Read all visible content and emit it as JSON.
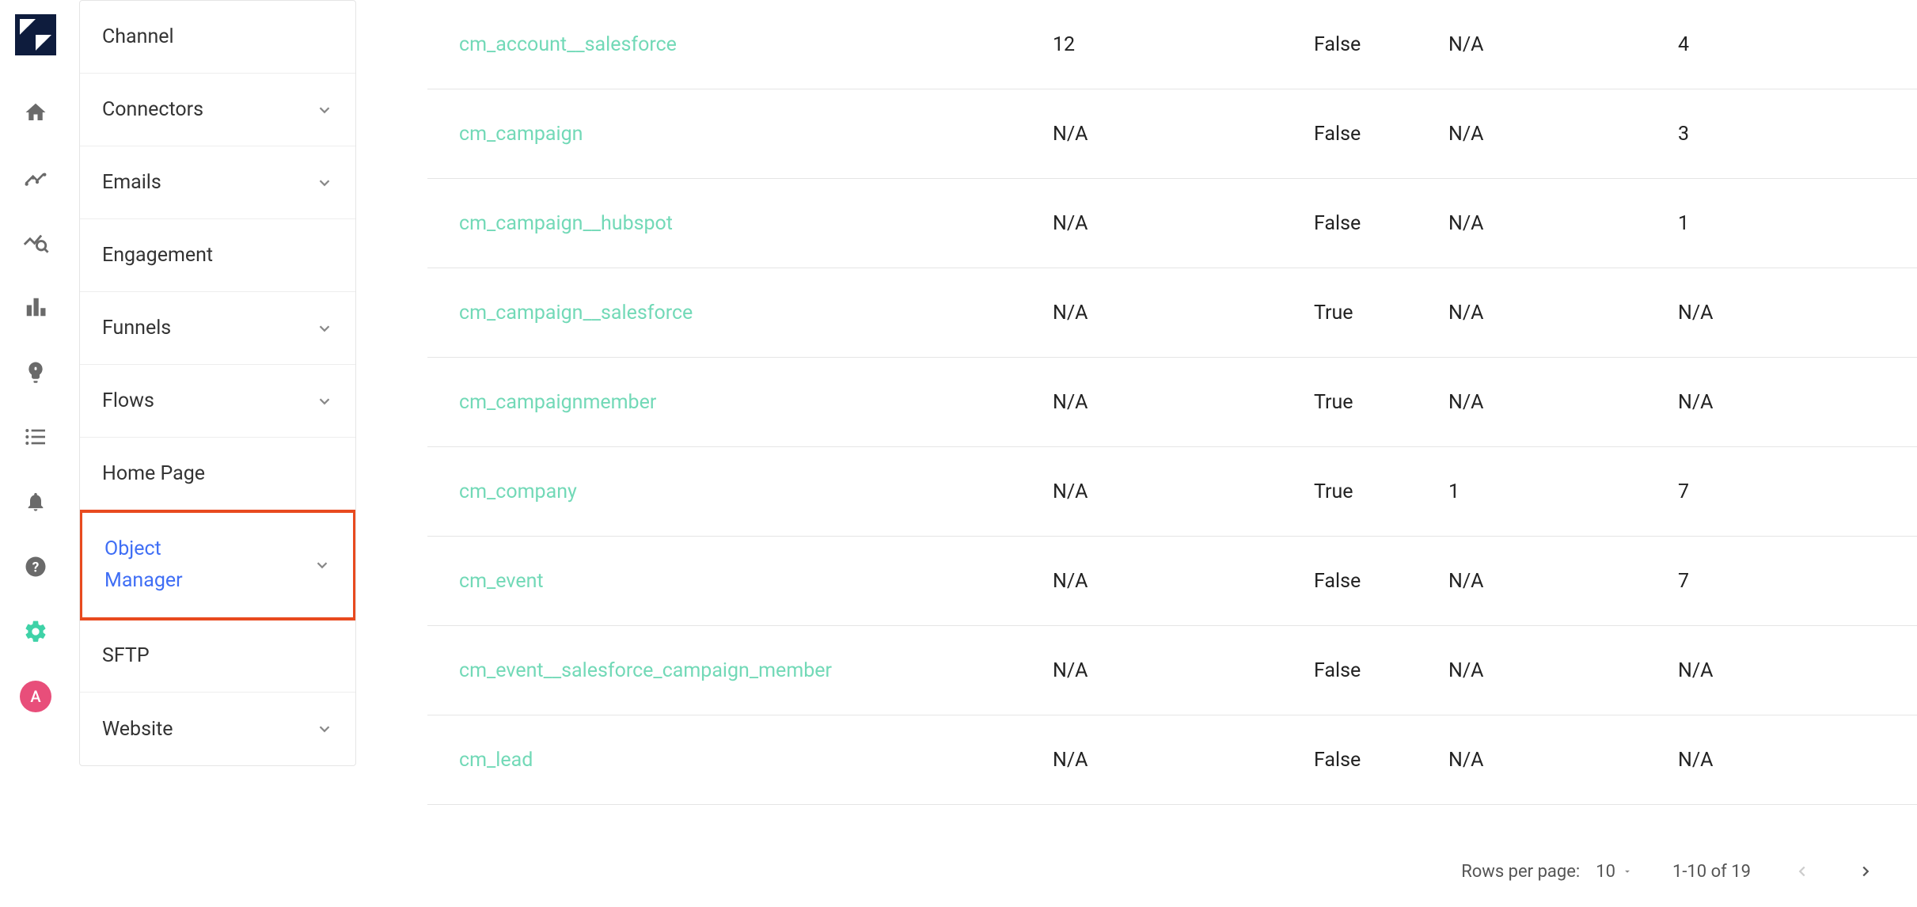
{
  "rail": {
    "avatar_letter": "A"
  },
  "sidebar": {
    "items": [
      {
        "label": "Channel",
        "expandable": false
      },
      {
        "label": "Connectors",
        "expandable": true
      },
      {
        "label": "Emails",
        "expandable": true
      },
      {
        "label": "Engagement",
        "expandable": false
      },
      {
        "label": "Funnels",
        "expandable": true
      },
      {
        "label": "Flows",
        "expandable": true
      },
      {
        "label": "Home Page",
        "expandable": false
      },
      {
        "label_line1": "Object",
        "label_line2": "Manager",
        "expandable": true,
        "highlighted": true
      },
      {
        "label": "SFTP",
        "expandable": false
      },
      {
        "label": "Website",
        "expandable": true
      }
    ]
  },
  "table": {
    "rows": [
      {
        "name": "cm_account__salesforce",
        "col2": "12",
        "col3": "False",
        "col4": "N/A",
        "col5": "4"
      },
      {
        "name": "cm_campaign",
        "col2": "N/A",
        "col3": "False",
        "col4": "N/A",
        "col5": "3"
      },
      {
        "name": "cm_campaign__hubspot",
        "col2": "N/A",
        "col3": "False",
        "col4": "N/A",
        "col5": "1"
      },
      {
        "name": "cm_campaign__salesforce",
        "col2": "N/A",
        "col3": "True",
        "col4": "N/A",
        "col5": "N/A"
      },
      {
        "name": "cm_campaignmember",
        "col2": "N/A",
        "col3": "True",
        "col4": "N/A",
        "col5": "N/A"
      },
      {
        "name": "cm_company",
        "col2": "N/A",
        "col3": "True",
        "col4": "1",
        "col5": "7"
      },
      {
        "name": "cm_event",
        "col2": "N/A",
        "col3": "False",
        "col4": "N/A",
        "col5": "7"
      },
      {
        "name": "cm_event__salesforce_campaign_member",
        "col2": "N/A",
        "col3": "False",
        "col4": "N/A",
        "col5": "N/A"
      },
      {
        "name": "cm_lead",
        "col2": "N/A",
        "col3": "False",
        "col4": "N/A",
        "col5": "N/A"
      }
    ]
  },
  "pagination": {
    "rows_per_page_label": "Rows per page:",
    "rows_per_page_value": "10",
    "range_text": "1-10 of 19"
  }
}
